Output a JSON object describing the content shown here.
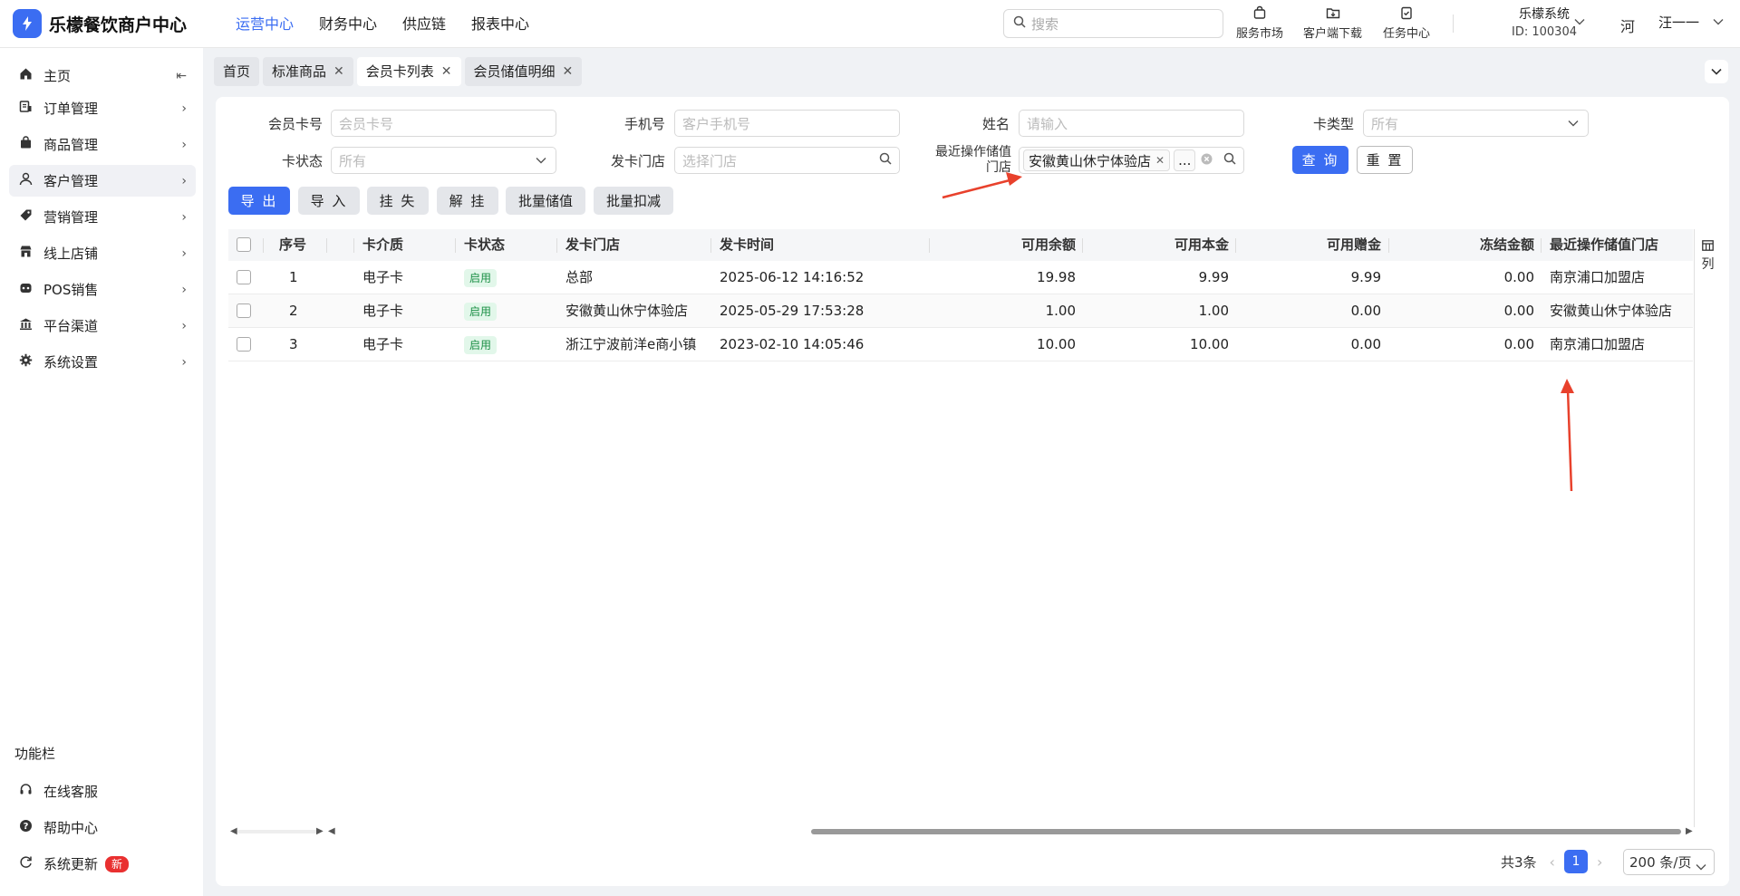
{
  "app": {
    "logo_letter": "",
    "name": "乐檬餐饮商户中心",
    "accent_color": "#3b6df2"
  },
  "topnav": [
    {
      "label": "运营中心",
      "active": true
    },
    {
      "label": "财务中心"
    },
    {
      "label": "供应链"
    },
    {
      "label": "报表中心"
    }
  ],
  "search": {
    "placeholder": "搜索",
    "icon": "search-icon"
  },
  "tools": [
    {
      "label": "服务市场",
      "icon": "bag-icon"
    },
    {
      "label": "客户端下载",
      "icon": "download-folder-icon"
    },
    {
      "label": "任务中心",
      "icon": "clipboard-icon"
    }
  ],
  "org": {
    "name": "乐檬系统",
    "id": "ID: 100304"
  },
  "user": {
    "avatar_text": "河",
    "name": "汪一一"
  },
  "sidebar": {
    "items": [
      {
        "label": "主页",
        "icon": "home-icon",
        "collapse_icon": "⇤"
      },
      {
        "label": "订单管理",
        "icon": "order-icon"
      },
      {
        "label": "商品管理",
        "icon": "goods-icon"
      },
      {
        "label": "客户管理",
        "icon": "user-icon",
        "active": true
      },
      {
        "label": "营销管理",
        "icon": "tag-icon"
      },
      {
        "label": "线上店铺",
        "icon": "store-icon"
      },
      {
        "label": "POS销售",
        "icon": "pos-icon"
      },
      {
        "label": "平台渠道",
        "icon": "bank-icon"
      },
      {
        "label": "系统设置",
        "icon": "gear-icon"
      }
    ],
    "section_title": "功能栏",
    "bottom_items": [
      {
        "label": "在线客服",
        "icon": "headset-icon"
      },
      {
        "label": "帮助中心",
        "icon": "help-icon"
      },
      {
        "label": "系统更新",
        "icon": "refresh-icon",
        "badge": "新"
      }
    ]
  },
  "tabs": [
    {
      "label": "首页",
      "closable": false
    },
    {
      "label": "标准商品",
      "closable": true
    },
    {
      "label": "会员卡列表",
      "closable": true,
      "active": true
    },
    {
      "label": "会员储值明细",
      "closable": true
    }
  ],
  "filters": {
    "card_no": {
      "label": "会员卡号",
      "placeholder": "会员卡号"
    },
    "phone": {
      "label": "手机号",
      "placeholder": "客户手机号"
    },
    "name": {
      "label": "姓名",
      "placeholder": "请输入"
    },
    "card_type": {
      "label": "卡类型",
      "value": "所有"
    },
    "card_status": {
      "label": "卡状态",
      "value": "所有"
    },
    "issue_store": {
      "label": "发卡门店",
      "placeholder": "选择门店"
    },
    "recent_store": {
      "label_line1": "最近操作储值",
      "label_line2": "门店",
      "tag": "安徽黄山休宁体验店",
      "more": "..."
    },
    "query_label": "查 询",
    "reset_label": "重 置"
  },
  "actions": [
    "导 出",
    "导 入",
    "挂 失",
    "解 挂",
    "批量储值",
    "批量扣减"
  ],
  "table": {
    "columns": [
      "序号",
      "卡介质",
      "卡状态",
      "发卡门店",
      "发卡时间",
      "可用余额",
      "可用本金",
      "可用赠金",
      "冻结金额",
      "最近操作储值门店"
    ],
    "rows": [
      {
        "no": "1",
        "medium": "电子卡",
        "status": "启用",
        "store": "总部",
        "time": "2025-06-12 14:16:52",
        "balance": "19.98",
        "principal": "9.99",
        "bonus": "9.99",
        "frozen": "0.00",
        "recent_store": "南京浦口加盟店"
      },
      {
        "no": "2",
        "medium": "电子卡",
        "status": "启用",
        "store": "安徽黄山休宁体验店",
        "time": "2025-05-29 17:53:28",
        "balance": "1.00",
        "principal": "1.00",
        "bonus": "0.00",
        "frozen": "0.00",
        "recent_store": "安徽黄山休宁体验店"
      },
      {
        "no": "3",
        "medium": "电子卡",
        "status": "启用",
        "store": "浙江宁波前洋e商小镇",
        "time": "2023-02-10 14:05:46",
        "balance": "10.00",
        "principal": "10.00",
        "bonus": "0.00",
        "frozen": "0.00",
        "recent_store": "南京浦口加盟店"
      }
    ],
    "column_settings_label": "列",
    "status_color": "#1b8f45"
  },
  "pagination": {
    "total": "共3条",
    "current": "1",
    "page_size": "200 条/页"
  },
  "annotation_color": "#e8412c"
}
